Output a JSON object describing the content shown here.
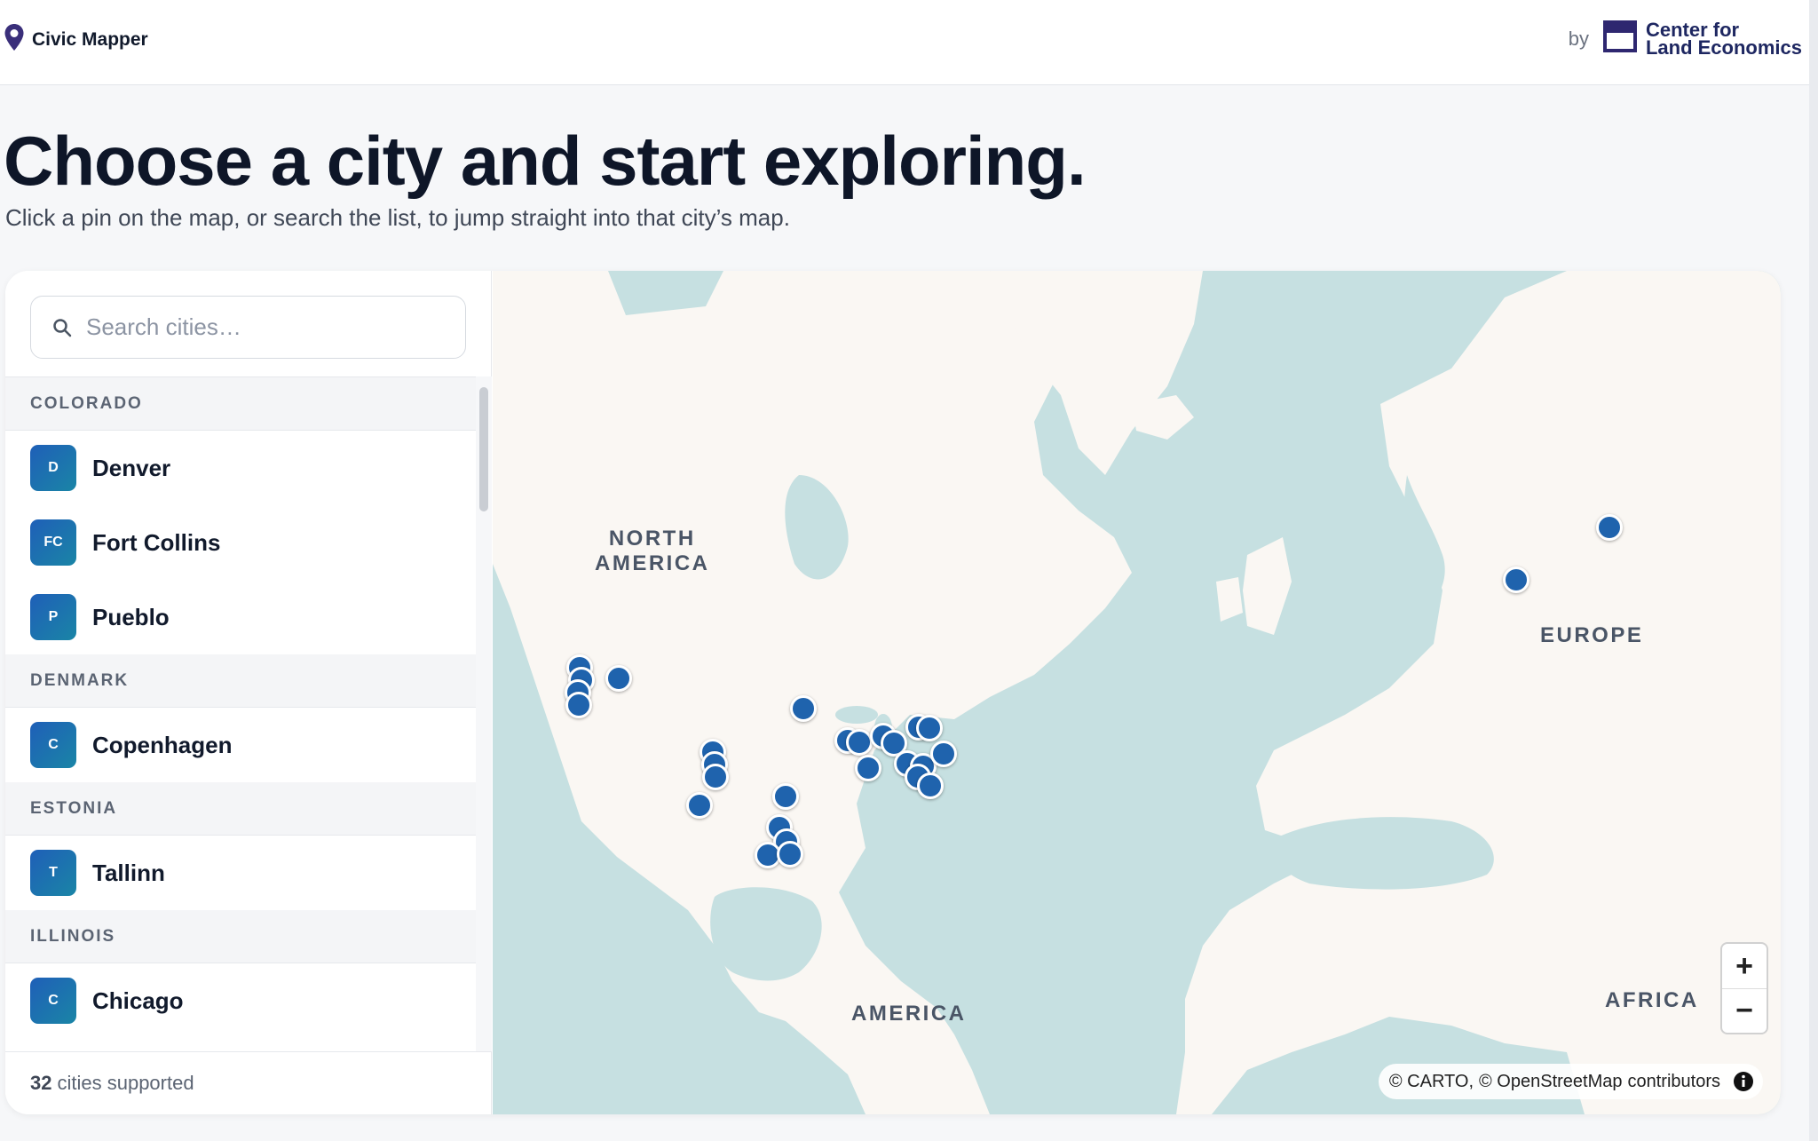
{
  "app": {
    "name": "Civic Mapper",
    "by_label": "by",
    "org_name_line1": "Center for",
    "org_name_line2": "Land Economics"
  },
  "hero": {
    "title": "Choose a city and start exploring.",
    "subtitle": "Click a pin on the map, or search the list, to jump straight into that city’s map."
  },
  "search": {
    "placeholder": "Search cities…",
    "value": ""
  },
  "groups": [
    {
      "heading": "COLORADO",
      "cities": [
        {
          "initials": "D",
          "name": "Denver"
        },
        {
          "initials": "FC",
          "name": "Fort Collins"
        },
        {
          "initials": "P",
          "name": "Pueblo"
        }
      ]
    },
    {
      "heading": "DENMARK",
      "cities": [
        {
          "initials": "C",
          "name": "Copenhagen"
        }
      ]
    },
    {
      "heading": "ESTONIA",
      "cities": [
        {
          "initials": "T",
          "name": "Tallinn"
        }
      ]
    },
    {
      "heading": "ILLINOIS",
      "cities": [
        {
          "initials": "C",
          "name": "Chicago"
        }
      ]
    }
  ],
  "footer": {
    "count": "32",
    "count_suffix": "cities supported"
  },
  "map": {
    "labels": {
      "north_america_line1": "NORTH",
      "north_america_line2": "AMERICA",
      "europe": "EUROPE",
      "america": "AMERICA",
      "africa": "AFRICA"
    },
    "attribution_carto": "© CARTO,",
    "attribution_osm": "© OpenStreetMap",
    "attribution_contrib": "contributors",
    "zoom_in": "+",
    "zoom_out": "−"
  },
  "colors": {
    "pin": "#1f63ad",
    "water": "#c6e0e1",
    "land": "#faf7f3",
    "brand": "#3a2f7a"
  },
  "icons": [
    "map-pin-icon",
    "org-logo-icon",
    "search-icon",
    "info-icon"
  ]
}
